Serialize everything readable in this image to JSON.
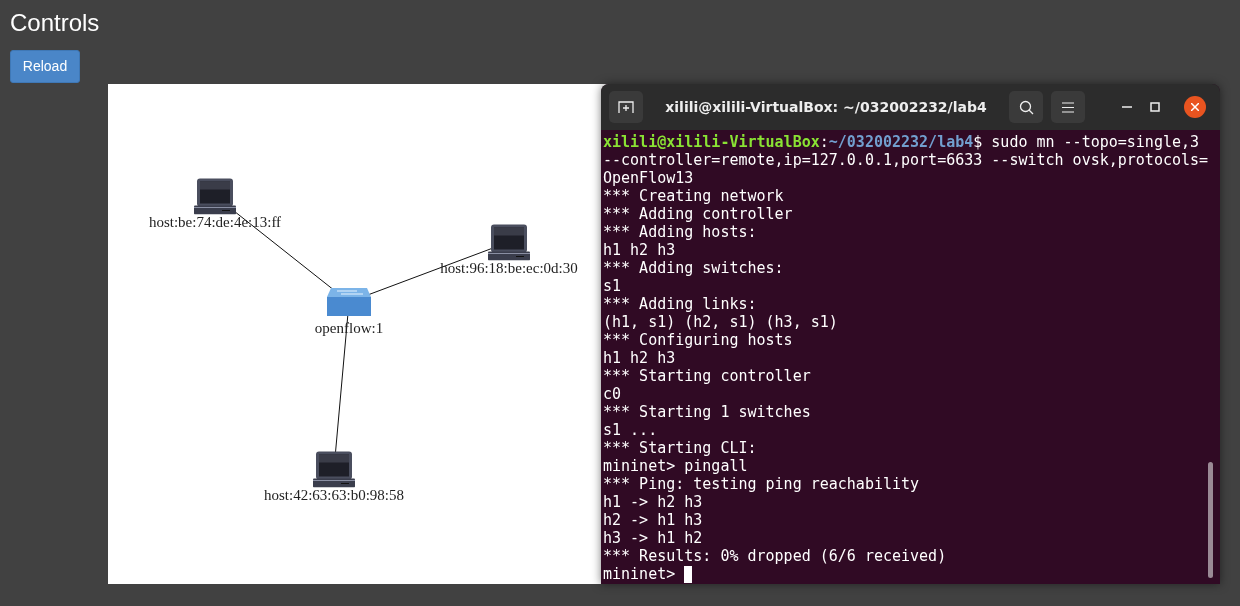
{
  "page": {
    "title": "Controls",
    "reload_button": "Reload"
  },
  "topology": {
    "nodes": [
      {
        "kind": "host",
        "label": "host:be:74:de:4e:13:ff"
      },
      {
        "kind": "host",
        "label": "host:96:18:be:ec:0d:30"
      },
      {
        "kind": "switch",
        "label": "openflow:1"
      },
      {
        "kind": "host",
        "label": "host:42:63:63:b0:98:58"
      }
    ]
  },
  "terminal": {
    "title": "xilili@xilili-VirtualBox: ~/032002232/lab4",
    "lines": [
      {
        "kind": "prompt",
        "user": "xilili@xilili-VirtualBox",
        "separator": ":",
        "path": "~/032002232/lab4",
        "command": "$ sudo mn --topo=single,3 --controller=remote,ip=127.0.0.1,port=6633 --switch ovsk,protocols=OpenFlow13"
      },
      {
        "kind": "output",
        "text": "*** Creating network"
      },
      {
        "kind": "output",
        "text": "*** Adding controller"
      },
      {
        "kind": "output",
        "text": "*** Adding hosts:"
      },
      {
        "kind": "output",
        "text": "h1 h2 h3"
      },
      {
        "kind": "output",
        "text": "*** Adding switches:"
      },
      {
        "kind": "output",
        "text": "s1"
      },
      {
        "kind": "output",
        "text": "*** Adding links:"
      },
      {
        "kind": "output",
        "text": "(h1, s1) (h2, s1) (h3, s1)"
      },
      {
        "kind": "output",
        "text": "*** Configuring hosts"
      },
      {
        "kind": "output",
        "text": "h1 h2 h3"
      },
      {
        "kind": "output",
        "text": "*** Starting controller"
      },
      {
        "kind": "output",
        "text": "c0"
      },
      {
        "kind": "output",
        "text": "*** Starting 1 switches"
      },
      {
        "kind": "output",
        "text": "s1 ..."
      },
      {
        "kind": "output",
        "text": "*** Starting CLI:"
      },
      {
        "kind": "output",
        "text": "mininet> pingall"
      },
      {
        "kind": "output",
        "text": "*** Ping: testing ping reachability"
      },
      {
        "kind": "output",
        "text": "h1 -> h2 h3"
      },
      {
        "kind": "output",
        "text": "h2 -> h1 h3"
      },
      {
        "kind": "output",
        "text": "h3 -> h1 h2"
      },
      {
        "kind": "output",
        "text": "*** Results: 0% dropped (6/6 received)"
      },
      {
        "kind": "cli",
        "text": "mininet>",
        "cursor": true
      }
    ]
  }
}
